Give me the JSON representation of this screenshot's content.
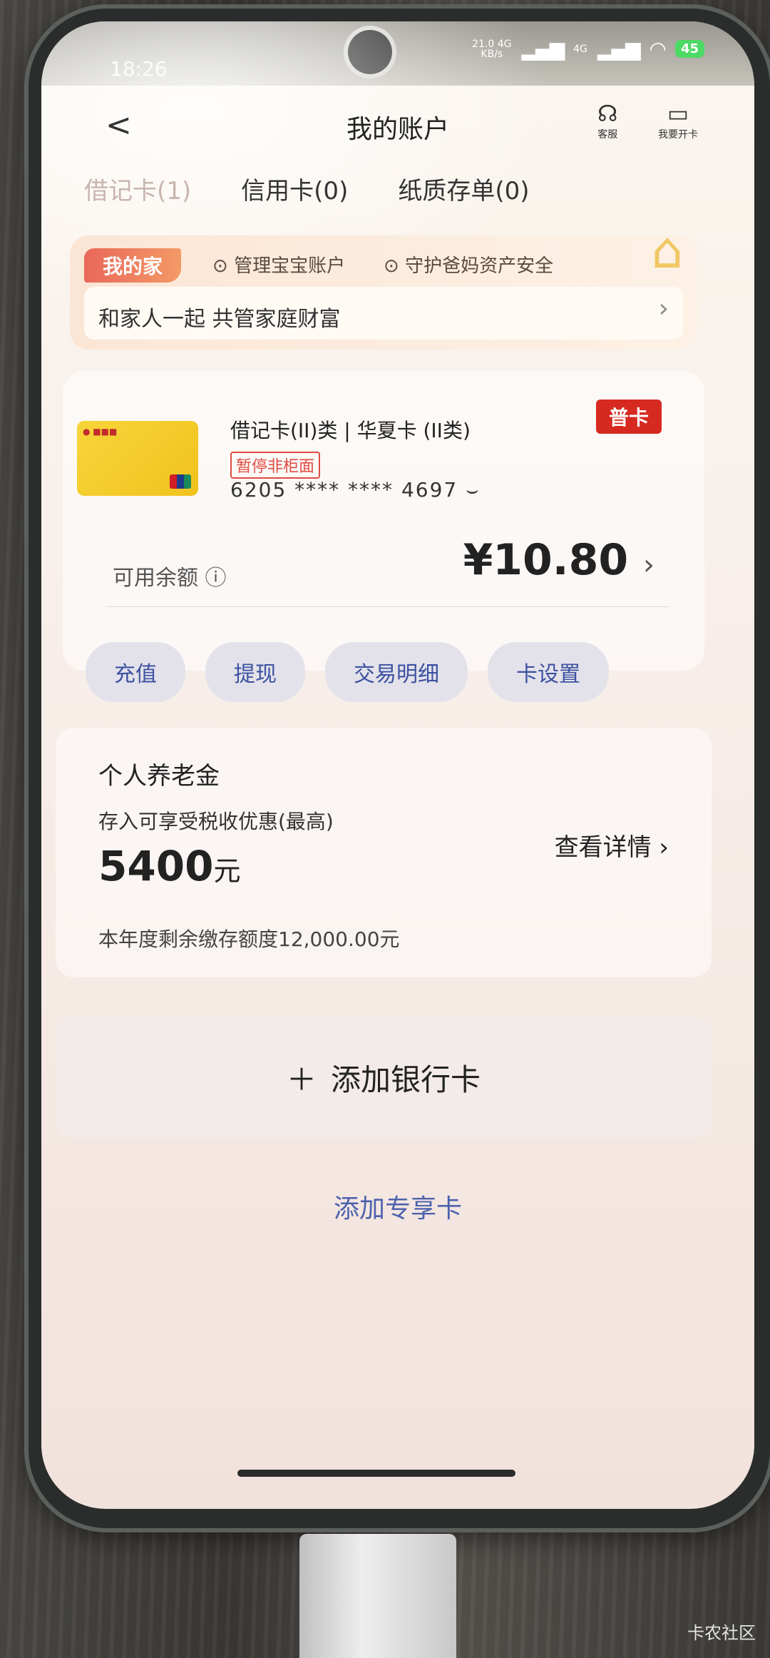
{
  "status_bar": {
    "time": "18:26",
    "net_speed": "21.0",
    "net_unit": "KB/s",
    "net_type_1": "4G",
    "net_type_2": "4G",
    "battery": "45"
  },
  "header": {
    "back_glyph": "<",
    "title": "我的账户",
    "customer_service_label": "客服",
    "open_card_label": "我要开卡"
  },
  "tabs": [
    {
      "label": "借记卡(1)"
    },
    {
      "label": "信用卡(0)"
    },
    {
      "label": "纸质存单(0)"
    }
  ],
  "family": {
    "badge": "我的家",
    "check_1": "管理宝宝账户",
    "check_2": "守护爸妈资产安全",
    "banner": "和家人一起 共管家庭财富"
  },
  "account_card": {
    "name": "借记卡(II)类 | 华夏卡 (II类)",
    "tier": "普卡",
    "status_tag": "暂停非柜面",
    "number": "6205 **** **** 4697",
    "balance_label": "可用余额",
    "balance": "¥10.80",
    "actions": [
      "充值",
      "提现",
      "交易明细",
      "卡设置"
    ]
  },
  "pension": {
    "title": "个人养老金",
    "subtitle": "存入可享受税收优惠(最高)",
    "amount": "5400",
    "amount_unit": "元",
    "footnote": "本年度剩余缴存额度12,000.00元",
    "detail_link": "查看详情"
  },
  "add_bank_card": "添加银行卡",
  "add_exclusive_card": "添加专享卡",
  "watermark": "卡农社区",
  "icons": {
    "back": "chevron-left-icon",
    "customer_service": "headset-icon",
    "open_card": "card-icon",
    "info": "info-icon",
    "add": "plus-icon"
  }
}
